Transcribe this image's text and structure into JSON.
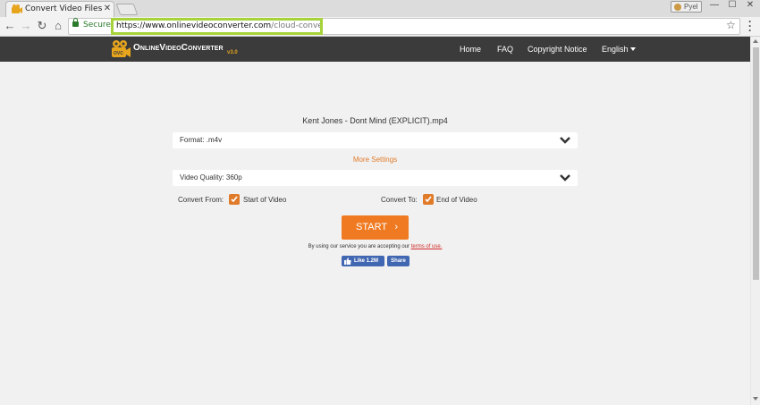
{
  "browser": {
    "tab": {
      "title": "Convert Video Files to M",
      "close_symbol": "✕"
    },
    "profile_chip": "Pyel",
    "window_controls": {
      "minimize": "—",
      "maximize": "☐",
      "close": "✕"
    },
    "nav": {
      "back": "←",
      "forward": "→",
      "reload": "↻",
      "home": "⌂"
    },
    "secure_label": "Secure",
    "url_host": "https://www.onlinevideoconverter.com",
    "url_path": "/cloud-converter",
    "bookmark_symbol": "☆"
  },
  "site": {
    "logo_text": "OnlineVideoConverter",
    "logo_version": "v3.0",
    "logo_badge": "OVC",
    "nav": {
      "home": "Home",
      "faq": "FAQ",
      "copyright": "Copyright Notice",
      "language": "English"
    }
  },
  "converter": {
    "filename": "Kent Jones - Dont Mind (EXPLICIT).mp4",
    "format": "Format: .m4v",
    "more_settings": "More Settings",
    "quality": "Video Quality: 360p",
    "convert_from_label": "Convert From:",
    "convert_from_value": "Start of Video",
    "convert_to_label": "Convert To:",
    "convert_to_value": "End of Video",
    "start_label": "START",
    "start_arrow": "›",
    "terms_prefix": "By using our service you are accepting our",
    "terms_link": "terms of use.",
    "fb_like": "Like 1.2M",
    "fb_share": "Share"
  },
  "colors": {
    "accent": "#f07a22",
    "header_bg": "#3b3b3b",
    "url_highlight": "#a6d33a",
    "facebook": "#4267b2"
  }
}
